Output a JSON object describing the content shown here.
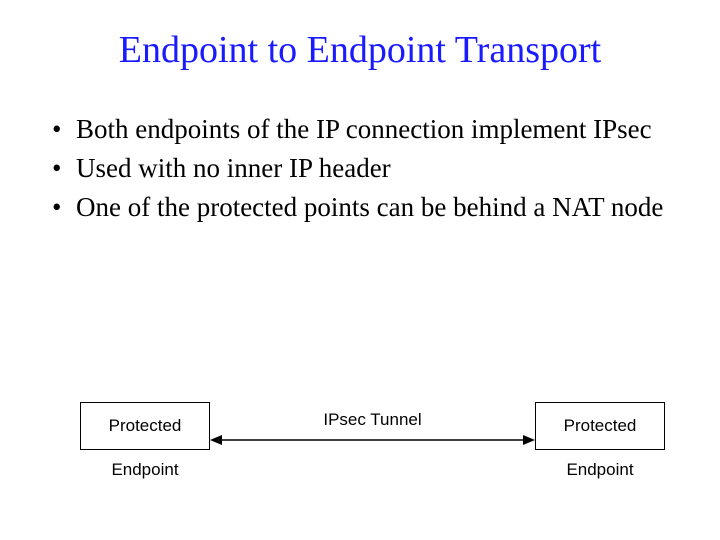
{
  "title": "Endpoint to Endpoint Transport",
  "bullets": [
    "Both endpoints of the IP connection implement IPsec",
    "Used with no inner IP header",
    "One of the protected points can be behind a NAT node"
  ],
  "diagram": {
    "left_box": "Protected",
    "right_box": "Protected",
    "left_caption": "Endpoint",
    "right_caption": "Endpoint",
    "tunnel_label": "IPsec Tunnel"
  }
}
